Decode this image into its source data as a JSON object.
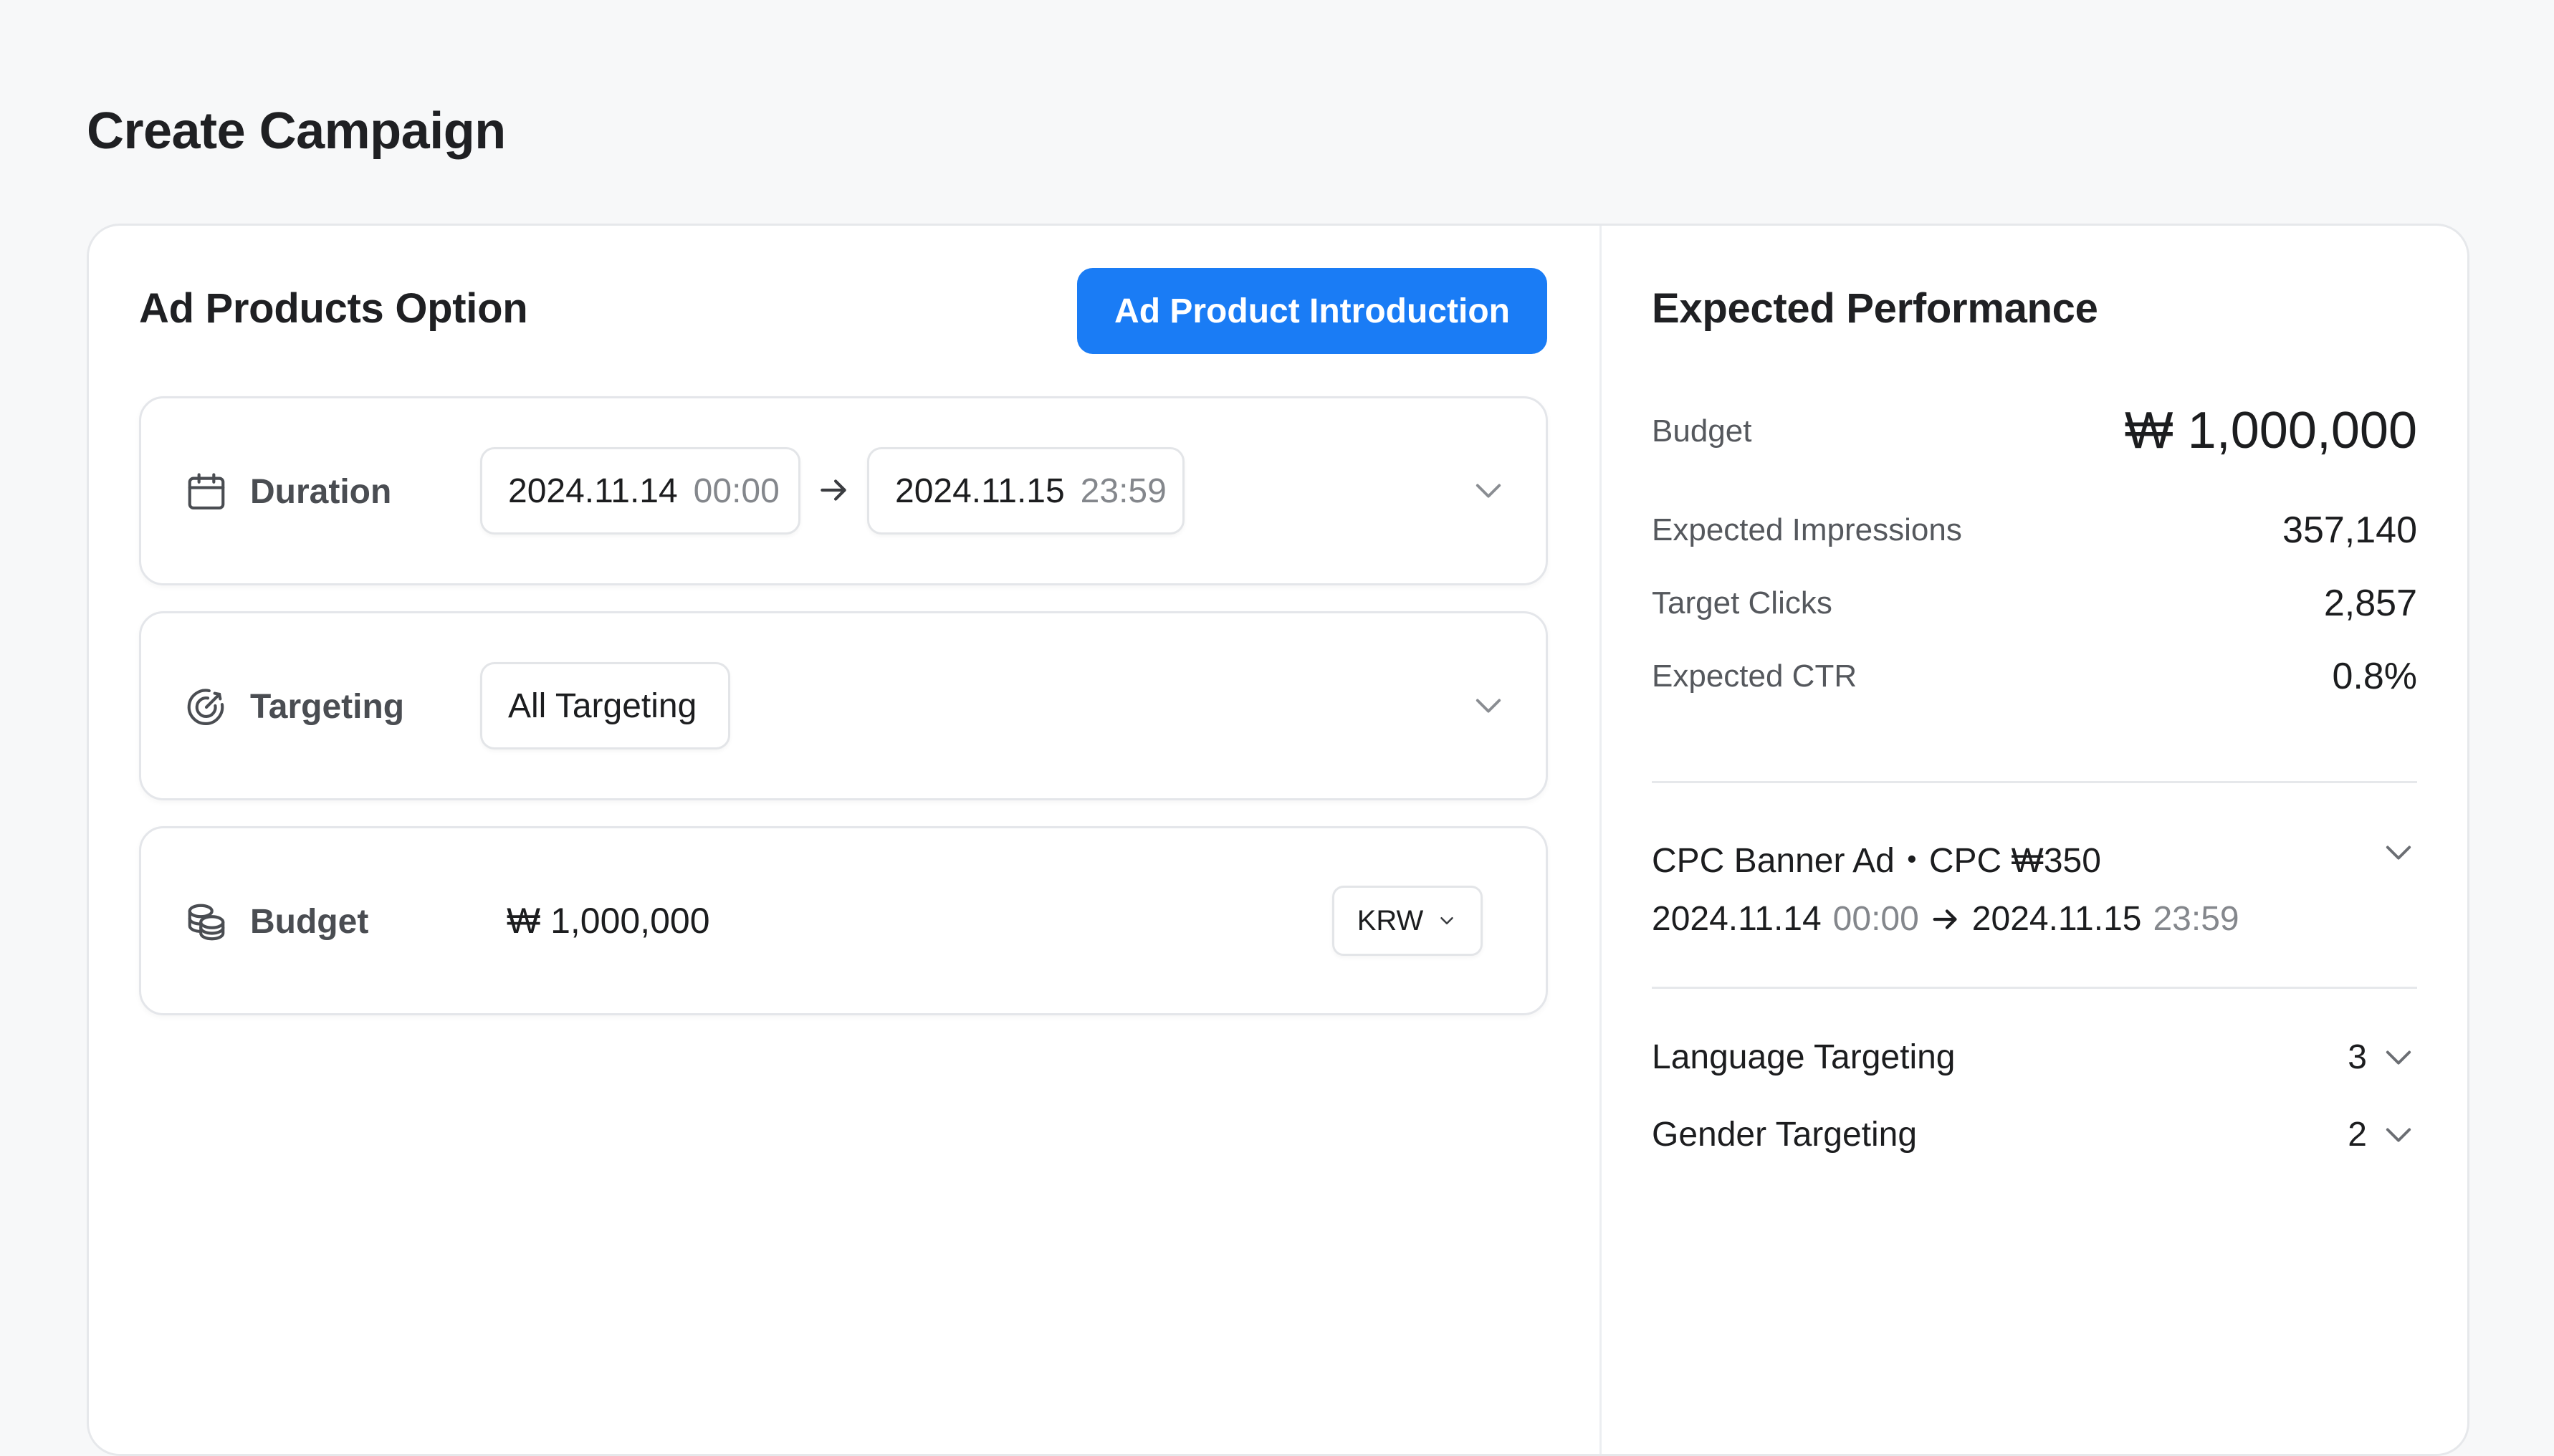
{
  "page": {
    "title": "Create Campaign"
  },
  "ad_products": {
    "title": "Ad Products Option",
    "intro_button": "Ad Product Introduction",
    "duration": {
      "label": "Duration",
      "start_date": "2024.11.14",
      "start_time": "00:00",
      "end_date": "2024.11.15",
      "end_time": "23:59"
    },
    "targeting": {
      "label": "Targeting",
      "value": "All Targeting"
    },
    "budget": {
      "label": "Budget",
      "value": "₩ 1,000,000",
      "currency": "KRW"
    }
  },
  "performance": {
    "title": "Expected Performance",
    "budget_label": "Budget",
    "budget_value": "₩ 1,000,000",
    "impressions_label": "Expected Impressions",
    "impressions_value": "357,140",
    "clicks_label": "Target Clicks",
    "clicks_value": "2,857",
    "ctr_label": "Expected CTR",
    "ctr_value": "0.8%",
    "product_summary": "CPC Banner Ad・CPC ₩350",
    "summary_start_date": "2024.11.14",
    "summary_start_time": "00:00",
    "summary_end_date": "2024.11.15",
    "summary_end_time": "23:59",
    "language_label": "Language Targeting",
    "language_count": "3",
    "gender_label": "Gender Targeting",
    "gender_count": "2"
  },
  "colors": {
    "accent": "#1a7cf5",
    "muted_text": "#84878c"
  },
  "icons": [
    "calendar-icon",
    "target-icon",
    "coins-icon",
    "arrow-right-icon",
    "chevron-down-icon"
  ]
}
